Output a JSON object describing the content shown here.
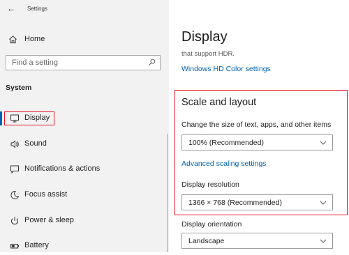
{
  "window": {
    "title": "Settings",
    "back_icon": "back-arrow-icon"
  },
  "sidebar": {
    "home_label": "Home",
    "search_placeholder": "Find a setting",
    "section_label": "System",
    "items": [
      {
        "label": "Display",
        "icon": "monitor-icon",
        "selected": true
      },
      {
        "label": "Sound",
        "icon": "speaker-icon"
      },
      {
        "label": "Notifications & actions",
        "icon": "notification-icon"
      },
      {
        "label": "Focus assist",
        "icon": "moon-icon"
      },
      {
        "label": "Power & sleep",
        "icon": "power-icon"
      },
      {
        "label": "Battery",
        "icon": "battery-icon"
      }
    ]
  },
  "main": {
    "title": "Display",
    "hdr_text": "that support HDR.",
    "hdr_link": "Windows HD Color settings",
    "scale": {
      "heading": "Scale and layout",
      "change_label": "Change the size of text, apps, and other items",
      "scale_value": "100% (Recommended)",
      "advanced_link": "Advanced scaling settings",
      "resolution_label": "Display resolution",
      "resolution_value": "1366 × 768 (Recommended)"
    },
    "orientation_label": "Display orientation",
    "orientation_value": "Landscape"
  },
  "colors": {
    "accent": "#0063b1",
    "highlight": "#e81123",
    "sidebar_bg": "#f2f2f2"
  }
}
